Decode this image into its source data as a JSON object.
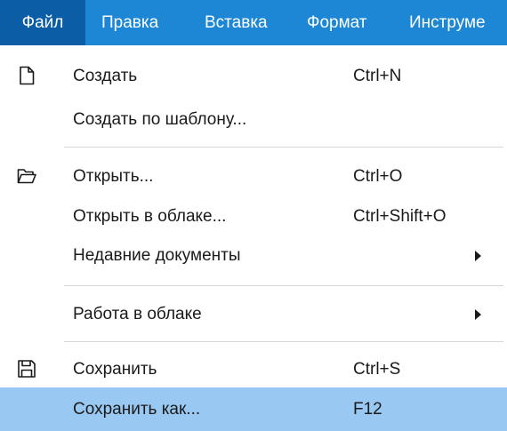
{
  "menubar": {
    "items": [
      {
        "label": "Файл",
        "active": true
      },
      {
        "label": "Правка"
      },
      {
        "label": "Вставка"
      },
      {
        "label": "Формат"
      },
      {
        "label": "Инструме"
      }
    ]
  },
  "file_menu": {
    "items": [
      {
        "label": "Создать",
        "shortcut": "Ctrl+N",
        "icon": "new-document-icon"
      },
      {
        "label": "Создать по шаблону..."
      },
      {
        "label": "Открыть...",
        "shortcut": "Ctrl+O",
        "icon": "open-folder-icon"
      },
      {
        "label": "Открыть в облаке...",
        "shortcut": "Ctrl+Shift+O"
      },
      {
        "label": "Недавние документы",
        "submenu": true
      },
      {
        "label": "Работа в облаке",
        "submenu": true
      },
      {
        "label": "Сохранить",
        "shortcut": "Ctrl+S",
        "icon": "save-icon"
      },
      {
        "label": "Сохранить как...",
        "shortcut": "F12",
        "selected": true
      }
    ]
  },
  "colors": {
    "menubar_bg": "#1d87d6",
    "menubar_active_bg": "#0b5ea6",
    "selected_item_bg": "#99c9f2",
    "separator": "#d6d6d6"
  }
}
